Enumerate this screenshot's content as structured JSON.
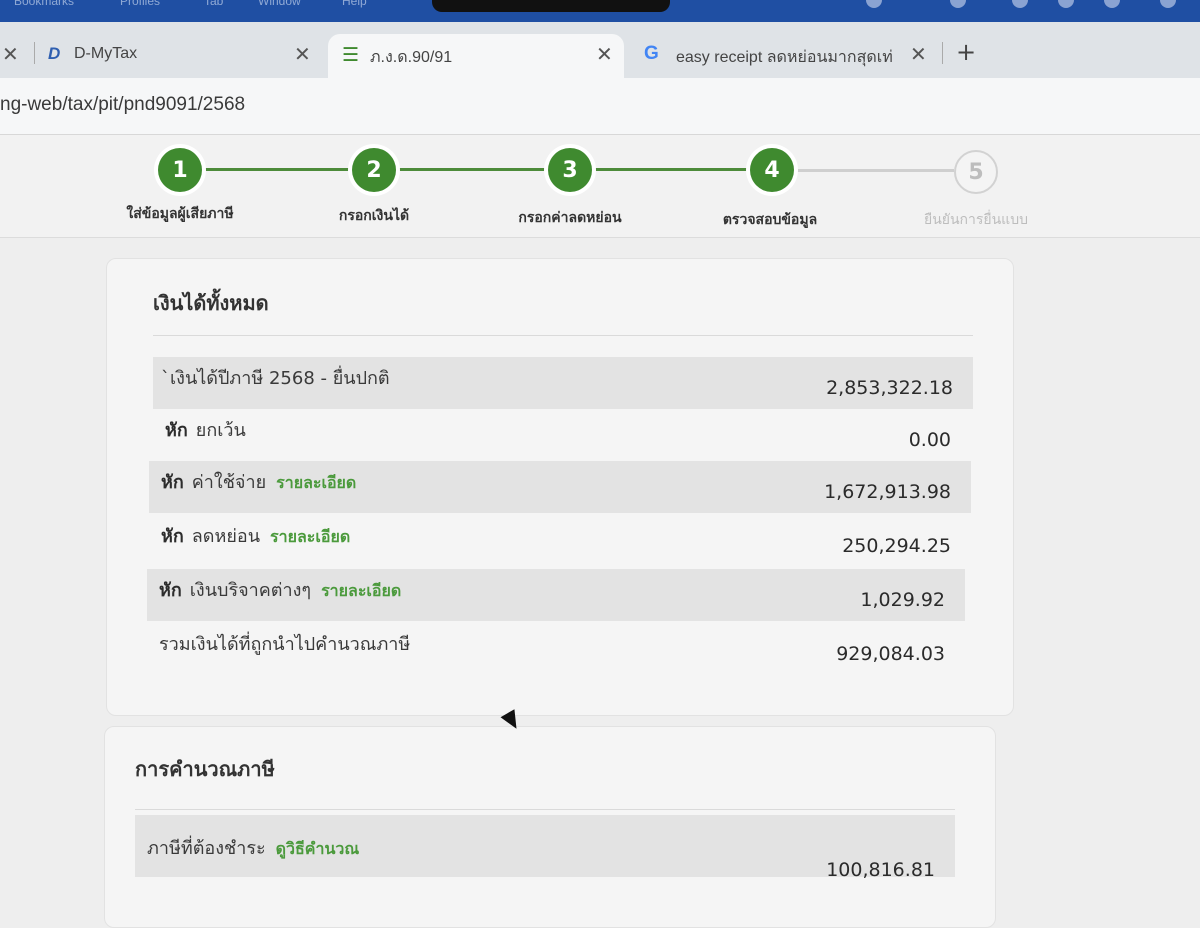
{
  "menubar": {
    "items": [
      "Bookmarks",
      "Profiles",
      "Tab",
      "Window",
      "Help"
    ]
  },
  "tabs": [
    {
      "title": "D-MyTax",
      "icon": "d-mytax-logo-icon"
    },
    {
      "title": "ภ.ง.ด.90/91",
      "icon": "form-list-icon",
      "active": true
    },
    {
      "title": "easy receipt ลดหย่อนมากสุดเท่",
      "icon": "google-icon"
    }
  ],
  "addressbar": {
    "url": "ng-web/tax/pit/pnd9091/2568"
  },
  "stepper": {
    "steps": [
      {
        "number": "1",
        "label": "ใส่ข้อมูลผู้เสียภาษี",
        "complete": true
      },
      {
        "number": "2",
        "label": "กรอกเงินได้",
        "complete": true
      },
      {
        "number": "3",
        "label": "กรอกค่าลดหย่อน",
        "complete": true
      },
      {
        "number": "4",
        "label": "ตรวจสอบข้อมูล",
        "complete": true
      },
      {
        "number": "5",
        "label": "ยืนยันการยื่นแบบ",
        "complete": false
      }
    ]
  },
  "income_card": {
    "title": "เงินได้ทั้งหมด",
    "rows": [
      {
        "prefix": "",
        "label": "`เงินได้ปีภาษี 2568 - ยื่นปกติ",
        "link": "",
        "amount": "2,853,322.18"
      },
      {
        "prefix": "หัก",
        "label": "ยกเว้น",
        "link": "",
        "amount": "0.00"
      },
      {
        "prefix": "หัก",
        "label": "ค่าใช้จ่าย",
        "link": "รายละเอียด",
        "amount": "1,672,913.98"
      },
      {
        "prefix": "หัก",
        "label": "ลดหย่อน",
        "link": "รายละเอียด",
        "amount": "250,294.25"
      },
      {
        "prefix": "หัก",
        "label": "เงินบริจาคต่างๆ",
        "link": "รายละเอียด",
        "amount": "1,029.92"
      },
      {
        "prefix": "",
        "label": "รวมเงินได้ที่ถูกนำไปคำนวณภาษี",
        "link": "",
        "amount": "929,084.03"
      }
    ]
  },
  "tax_card": {
    "title": "การคำนวณภาษี",
    "rows": [
      {
        "label": "ภาษีที่ต้องชำระ",
        "link": "ดูวิธีคำนวณ",
        "amount": "100,816.81"
      }
    ]
  },
  "colors": {
    "accent_green": "#3f8a2f",
    "link_green": "#4b9a3c"
  }
}
